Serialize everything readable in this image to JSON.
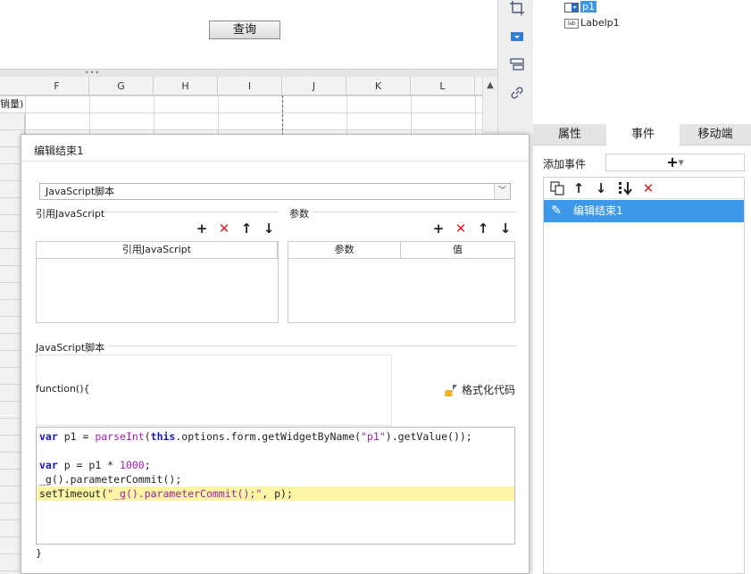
{
  "preview": {
    "query_button": "查询"
  },
  "sheet": {
    "columns": [
      "F",
      "G",
      "H",
      "I",
      "J",
      "K",
      "L"
    ],
    "cell_text": "销量)"
  },
  "tree": {
    "item_p1": "p1",
    "item_label": "Labelp1"
  },
  "tabs": [
    {
      "label": "属性",
      "active": false
    },
    {
      "label": "事件",
      "active": true
    },
    {
      "label": "移动端",
      "active": false
    }
  ],
  "event_panel": {
    "add_event_label": "添加事件",
    "add_button": "+",
    "selected_event": "编辑结束1"
  },
  "dialog": {
    "title": "编辑结束1",
    "script_type": "JavaScript脚本",
    "ref_js_section": "引用JavaScript",
    "param_section": "参数",
    "ref_js_column": "引用JavaScript",
    "param_columns": [
      "参数",
      "值"
    ],
    "script_section": "JavaScript脚本",
    "fn_open": "function(){",
    "format_button": "格式化代码",
    "fn_close": "}",
    "code_lines": [
      "var p1 = parseInt(this.options.form.getWidgetByName(\"p1\").getValue());",
      "",
      "var p = p1 * 1000;",
      "_g().parameterCommit();",
      "setTimeout(\"_g().parameterCommit();\", p);"
    ]
  },
  "colors": {
    "selection_blue": "#3e98e8",
    "highlight_line": "#fbf5a4",
    "delete_red": "#e02020",
    "keyword_blue": "#1a16c8",
    "string_purple": "#a31ab8"
  }
}
